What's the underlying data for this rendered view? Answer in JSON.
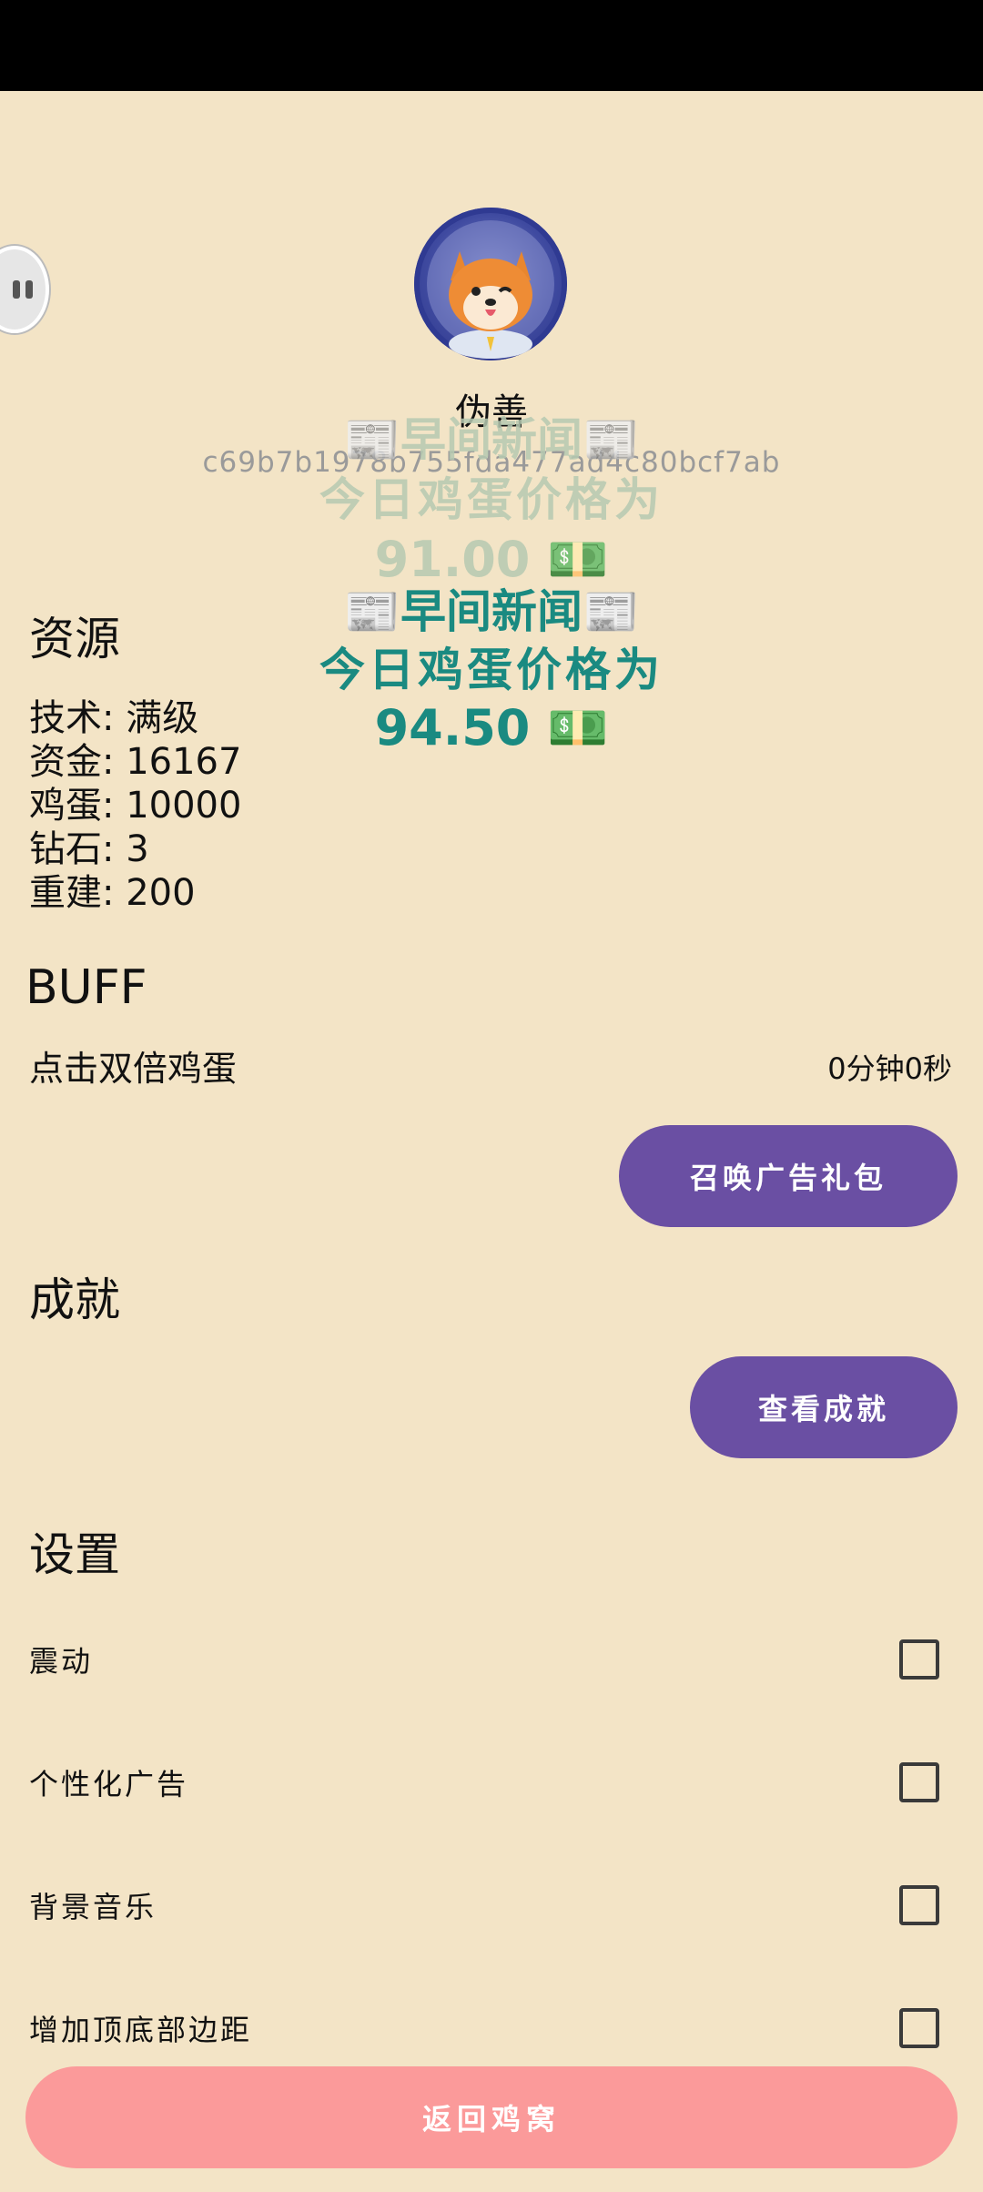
{
  "profile": {
    "username": "伪善",
    "user_id": "c69b7b1978b755fda477ad4c80bcf7ab"
  },
  "news_ghost": {
    "title": "📰早间新闻📰",
    "line": "今日鸡蛋价格为",
    "price": "91.00 💵"
  },
  "news": {
    "title": "📰早间新闻📰",
    "line": "今日鸡蛋价格为",
    "price": "94.50 💵"
  },
  "resources": {
    "title": "资源",
    "tech": "技术: 满级",
    "funds": "资金: 16167",
    "eggs": "鸡蛋: 10000",
    "diamonds": "钻石: 3",
    "rebuild": "重建: 200"
  },
  "buff": {
    "title": "BUFF",
    "name": "点击双倍鸡蛋",
    "timer": "0分钟0秒",
    "ad_button": "召唤广告礼包"
  },
  "achievements": {
    "title": "成就",
    "view_button": "查看成就"
  },
  "settings": {
    "title": "设置",
    "items": [
      {
        "label": "震动",
        "checked": false
      },
      {
        "label": "个性化广告",
        "checked": false
      },
      {
        "label": "背景音乐",
        "checked": false
      },
      {
        "label": "增加顶底部边距",
        "checked": false
      }
    ]
  },
  "footer": {
    "back_button": "返回鸡窝"
  },
  "colors": {
    "background": "#f3e4c6",
    "news_text": "#1a8a81",
    "purple_button": "#6a4fa3",
    "back_button": "#fb9a9a"
  }
}
